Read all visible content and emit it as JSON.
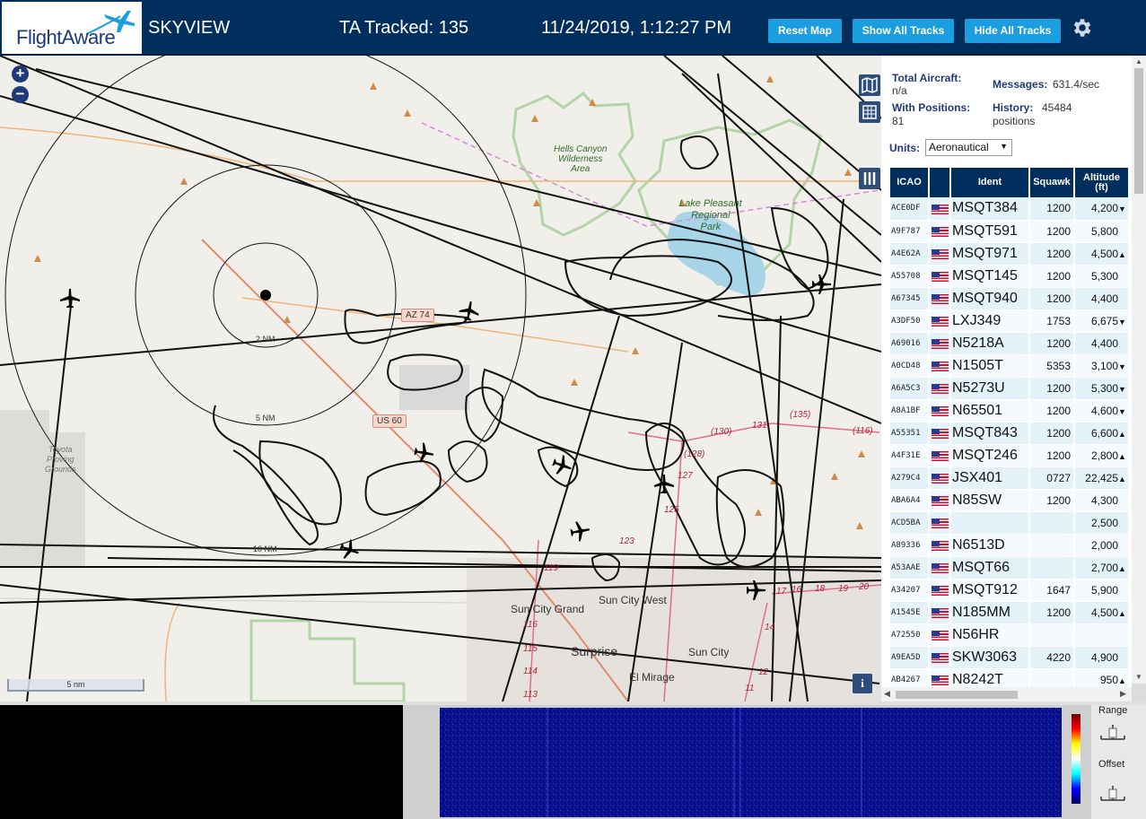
{
  "header": {
    "logo_text": "FlightAware",
    "app_title": "SKYVIEW",
    "ta_tracked": "TA Tracked: 135",
    "clock": "11/24/2019, 1:12:27 PM",
    "reset_map": "Reset Map",
    "show_all": "Show All Tracks",
    "hide_all": "Hide All Tracks"
  },
  "map": {
    "labels": {
      "hells_canyon": "Hells Canyon\nWilderness\nArea",
      "lake_pleasant": "Lake Pleasant\nRegional\nPark",
      "toyota": "Toyota\nProving\nGrounds",
      "sun_city_west": "Sun City West",
      "sun_city_grand": "Sun City Grand",
      "sun_city": "Sun City",
      "surprise": "Surprise",
      "el_mirage": "El Mirage",
      "ring_2nm": "2 NM",
      "ring_5nm": "5 NM",
      "ring_10nm": "10 NM",
      "us60": "US 60",
      "az74": "AZ 74",
      "rd_130": "(130)",
      "rd_131": "131",
      "rd_135": "(135)",
      "rd_116": "(116)",
      "rd_128": "(128)",
      "rd_127": "127",
      "rd_125": "125",
      "rd_123": "123",
      "rd_119": "119",
      "rd_116b": "116",
      "rd_115": "115",
      "rd_114": "114",
      "rd_113": "113",
      "rd_17": "17",
      "rd_16": "16",
      "rd_18": "18",
      "rd_19": "19",
      "rd_20": "20",
      "rd_14": "14",
      "rd_12": "12",
      "rd_11": "11"
    },
    "scale": "5 nm",
    "zoom_in": "+",
    "zoom_out": "−",
    "info": "i"
  },
  "sidebar": {
    "total_aircraft_label": "Total Aircraft:",
    "total_aircraft_value": "n/a",
    "with_positions_label": "With Positions:",
    "with_positions_value": "81",
    "messages_label": "Messages:",
    "messages_value": "631.4/sec",
    "history_label": "History:",
    "history_value": "45484",
    "history_unit": "positions",
    "units_label": "Units:",
    "units_value": "Aeronautical",
    "columns": [
      "ICAO",
      "",
      "Ident",
      "Squawk",
      "Altitude\n(ft)"
    ],
    "rows": [
      {
        "icao": "ACE0DF",
        "ident": "MSQT384",
        "squawk": "1200",
        "alt": "4,200",
        "trend": "▼"
      },
      {
        "icao": "A9F787",
        "ident": "MSQT591",
        "squawk": "1200",
        "alt": "5,800",
        "trend": ""
      },
      {
        "icao": "A4E62A",
        "ident": "MSQT971",
        "squawk": "1200",
        "alt": "4,500",
        "trend": "▲"
      },
      {
        "icao": "A55708",
        "ident": "MSQT145",
        "squawk": "1200",
        "alt": "5,300",
        "trend": ""
      },
      {
        "icao": "A67345",
        "ident": "MSQT940",
        "squawk": "1200",
        "alt": "4,400",
        "trend": ""
      },
      {
        "icao": "A3DF50",
        "ident": "LXJ349",
        "squawk": "1753",
        "alt": "6,675",
        "trend": "▼"
      },
      {
        "icao": "A69016",
        "ident": "N5218A",
        "squawk": "1200",
        "alt": "4,400",
        "trend": ""
      },
      {
        "icao": "A0CD48",
        "ident": "N1505T",
        "squawk": "5353",
        "alt": "3,100",
        "trend": "▼"
      },
      {
        "icao": "A6A5C3",
        "ident": "N5273U",
        "squawk": "1200",
        "alt": "5,300",
        "trend": "▼"
      },
      {
        "icao": "A8A1BF",
        "ident": "N65501",
        "squawk": "1200",
        "alt": "4,600",
        "trend": "▼"
      },
      {
        "icao": "A55351",
        "ident": "MSQT843",
        "squawk": "1200",
        "alt": "6,600",
        "trend": "▲"
      },
      {
        "icao": "A4F31E",
        "ident": "MSQT246",
        "squawk": "1200",
        "alt": "2,800",
        "trend": "▲"
      },
      {
        "icao": "A279C4",
        "ident": "JSX401",
        "squawk": "0727",
        "alt": "22,425",
        "trend": "▲"
      },
      {
        "icao": "ABA6A4",
        "ident": "N85SW",
        "squawk": "1200",
        "alt": "4,300",
        "trend": ""
      },
      {
        "icao": "ACD5BA",
        "ident": "",
        "squawk": "",
        "alt": "2,500",
        "trend": ""
      },
      {
        "icao": "A89336",
        "ident": "N6513D",
        "squawk": "",
        "alt": "2,000",
        "trend": ""
      },
      {
        "icao": "A53AAE",
        "ident": "MSQT66",
        "squawk": "",
        "alt": "2,700",
        "trend": "▲"
      },
      {
        "icao": "A34207",
        "ident": "MSQT912",
        "squawk": "1647",
        "alt": "5,900",
        "trend": ""
      },
      {
        "icao": "A1545E",
        "ident": "N185MM",
        "squawk": "1200",
        "alt": "4,500",
        "trend": "▲"
      },
      {
        "icao": "A72550",
        "ident": "N56HR",
        "squawk": "",
        "alt": "",
        "trend": ""
      },
      {
        "icao": "A9EA5D",
        "ident": "SKW3063",
        "squawk": "4220",
        "alt": "4,900",
        "trend": ""
      },
      {
        "icao": "AB4267",
        "ident": "N8242T",
        "squawk": "",
        "alt": "950",
        "trend": "▲"
      }
    ]
  },
  "bottom": {
    "range_label": "Range",
    "offset_label": "Offset"
  },
  "colors": {
    "header_bg": "#002f5d",
    "button_bg": "#1b9ee0",
    "track": "#111111",
    "row_odd": "#e4f2fa",
    "row_even": "#f4fafd"
  },
  "icons": [
    "airplane-icon",
    "gear-icon",
    "map-layers-icon",
    "grid-icon",
    "columns-icon",
    "info-icon",
    "us-flag-icon"
  ]
}
